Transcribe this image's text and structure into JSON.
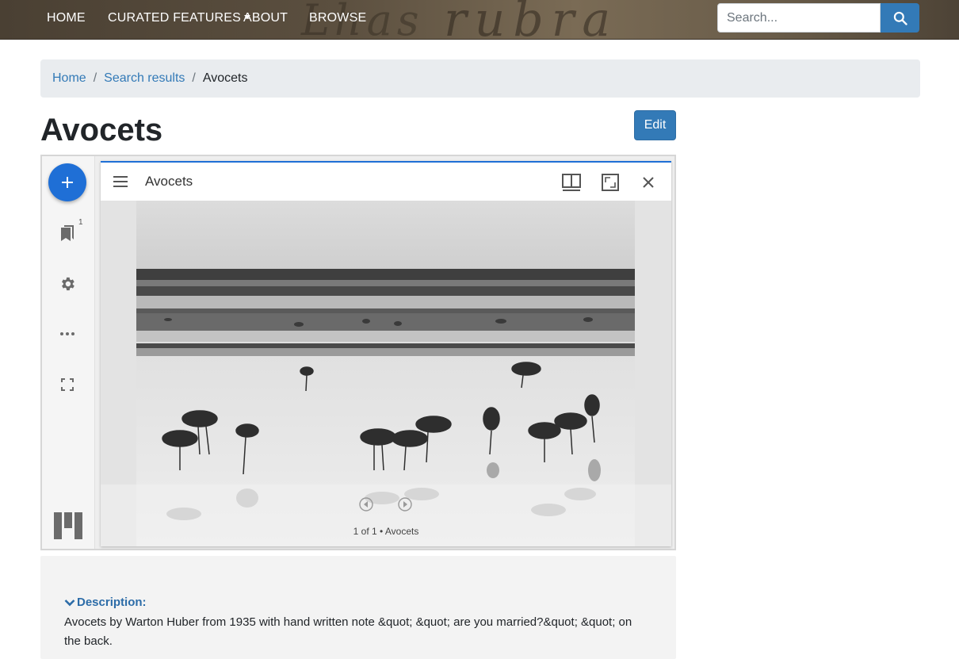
{
  "nav": {
    "items": [
      "HOME",
      "CURATED FEATURES",
      "ABOUT",
      "BROWSE"
    ],
    "search_placeholder": "Search..."
  },
  "breadcrumb": {
    "home": "Home",
    "results": "Search results",
    "current": "Avocets",
    "separator": "/"
  },
  "page": {
    "title": "Avocets",
    "edit_label": "Edit"
  },
  "viewer": {
    "window_title": "Avocets",
    "index_count": "1",
    "caption": "1 of 1 • Avocets",
    "icons": [
      "add-icon",
      "bookmark-icon",
      "gear-icon",
      "more-icon",
      "fullscreen-icon",
      "mirador-logo",
      "hamburger-icon",
      "book-view-icon",
      "maximize-icon",
      "close-icon",
      "previous-icon",
      "next-icon"
    ]
  },
  "description": {
    "label": "Description:",
    "text": "Avocets by Warton Huber from 1935 with hand written note &quot; &quot; are you married?&quot; &quot; on the back."
  },
  "colors": {
    "primary": "#337ab7",
    "mirador_blue": "#1f6fd6",
    "breadcrumb_bg": "#e9ecef",
    "description_bg": "#f3f3f3"
  }
}
